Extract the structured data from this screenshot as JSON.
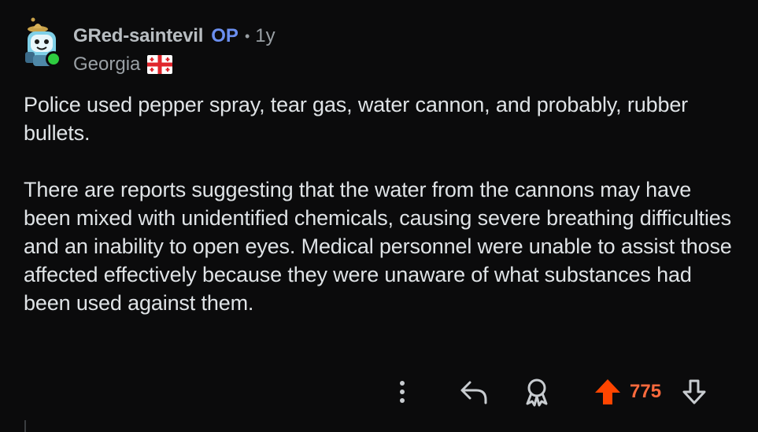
{
  "comment": {
    "author": "GRed-saintevil",
    "op_badge": "OP",
    "separator": "•",
    "age": "1y",
    "flair_text": "Georgia",
    "flair_icon": "georgia-flag-icon",
    "paragraphs": [
      "Police used pepper spray, tear gas, water cannon, and probably, rubber bullets.",
      "There are reports suggesting that the water from the cannons may have been mixed with unidentified chemicals, causing severe breathing difficulties and an inability to open eyes. Medical personnel were unable to assist those affected effectively because they were unaware of what substances had been used against them."
    ],
    "actions": {
      "more_icon": "more-vertical-icon",
      "reply_icon": "reply-icon",
      "award_icon": "award-icon",
      "upvote_icon": "upvote-icon",
      "downvote_icon": "downvote-icon",
      "score": "775"
    }
  },
  "colors": {
    "background": "#0b0b0c",
    "text": "#dfe3e6",
    "muted": "#9aa0a5",
    "op": "#6b8ff0",
    "upvoted": "#ff4500",
    "online": "#2ecc40"
  }
}
